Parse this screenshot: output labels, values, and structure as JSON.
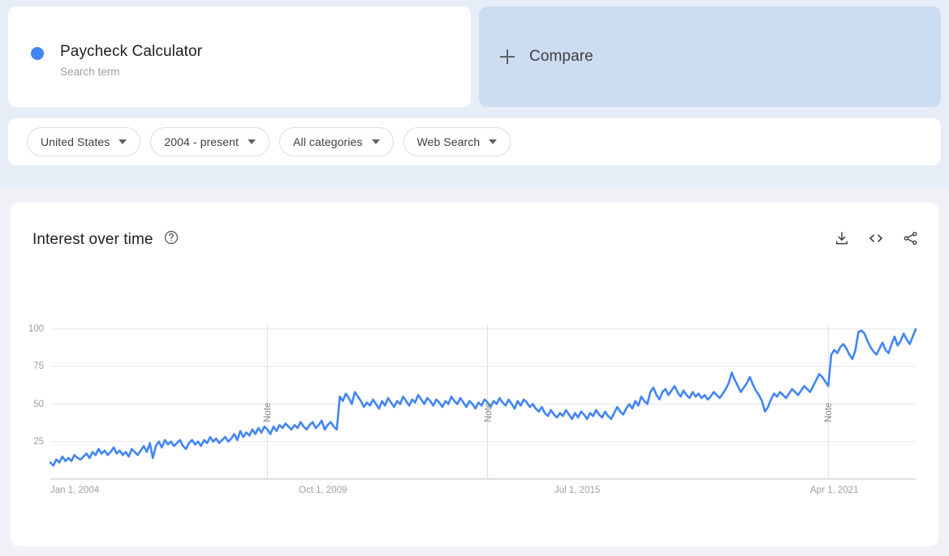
{
  "search_term": {
    "title": "Paycheck Calculator",
    "subtitle": "Search term",
    "dot_color": "#4285f4"
  },
  "compare": {
    "label": "Compare",
    "icon": "plus-icon",
    "background": "#ccdcf1"
  },
  "filters": [
    {
      "label": "United States",
      "icon": "chevron-down-icon"
    },
    {
      "label": "2004 - present",
      "icon": "chevron-down-icon"
    },
    {
      "label": "All categories",
      "icon": "chevron-down-icon"
    },
    {
      "label": "Web Search",
      "icon": "chevron-down-icon"
    }
  ],
  "chart_card": {
    "title": "Interest over time",
    "help_icon": "help-circle-icon",
    "actions": [
      {
        "name": "download-icon"
      },
      {
        "name": "embed-code-icon"
      },
      {
        "name": "share-icon"
      }
    ]
  },
  "chart_data": {
    "type": "line",
    "title": "Interest over time",
    "xlabel": "",
    "ylabel": "",
    "ylim": [
      0,
      100
    ],
    "grid": true,
    "legend_position": "none",
    "line_color": "#4285f4",
    "series_name": "Paycheck Calculator",
    "ticks": {
      "y": [
        25,
        50,
        75,
        100
      ],
      "x": [
        "Jan 1, 2004",
        "Oct 1, 2009",
        "Jul 1, 2015",
        "Apr 1, 2021"
      ]
    },
    "annotations": [
      {
        "label": "Note",
        "x_index": 72
      },
      {
        "label": "Note",
        "x_index": 145
      },
      {
        "label": "Note",
        "x_index": 258
      }
    ],
    "x_labels": [
      "Jan 1, 2004",
      "Oct 1, 2009",
      "Jul 1, 2015",
      "Apr 1, 2021"
    ],
    "values": [
      11,
      9,
      13,
      11,
      15,
      12,
      14,
      12,
      16,
      14,
      13,
      15,
      17,
      14,
      18,
      16,
      20,
      17,
      19,
      16,
      18,
      21,
      17,
      19,
      16,
      18,
      15,
      20,
      18,
      16,
      19,
      22,
      18,
      24,
      14,
      22,
      25,
      21,
      26,
      23,
      25,
      22,
      24,
      26,
      22,
      20,
      24,
      26,
      23,
      25,
      22,
      26,
      24,
      28,
      25,
      27,
      24,
      26,
      28,
      25,
      27,
      30,
      26,
      32,
      28,
      31,
      29,
      33,
      30,
      34,
      31,
      35,
      33,
      30,
      35,
      32,
      36,
      34,
      37,
      35,
      33,
      36,
      34,
      38,
      35,
      33,
      36,
      38,
      34,
      36,
      39,
      33,
      36,
      38,
      35,
      33,
      55,
      52,
      57,
      54,
      50,
      58,
      55,
      52,
      48,
      51,
      49,
      53,
      50,
      47,
      52,
      49,
      54,
      51,
      48,
      52,
      50,
      55,
      52,
      49,
      53,
      51,
      56,
      53,
      50,
      54,
      52,
      49,
      53,
      51,
      48,
      52,
      50,
      55,
      52,
      50,
      54,
      51,
      48,
      52,
      50,
      47,
      51,
      49,
      53,
      51,
      48,
      52,
      50,
      54,
      51,
      49,
      53,
      50,
      47,
      52,
      49,
      53,
      51,
      48,
      50,
      47,
      45,
      48,
      44,
      42,
      46,
      43,
      41,
      44,
      42,
      46,
      43,
      40,
      44,
      41,
      45,
      43,
      40,
      44,
      42,
      46,
      43,
      41,
      45,
      42,
      40,
      44,
      48,
      45,
      43,
      47,
      50,
      47,
      52,
      49,
      55,
      52,
      50,
      58,
      61,
      56,
      53,
      58,
      60,
      56,
      59,
      62,
      58,
      55,
      59,
      56,
      54,
      58,
      55,
      57,
      54,
      56,
      53,
      55,
      58,
      56,
      54,
      57,
      60,
      64,
      71,
      66,
      62,
      58,
      61,
      64,
      68,
      63,
      59,
      56,
      52,
      45,
      48,
      53,
      57,
      55,
      58,
      56,
      54,
      57,
      60,
      58,
      56,
      59,
      62,
      60,
      58,
      62,
      66,
      70,
      68,
      65,
      62,
      83,
      86,
      84,
      88,
      90,
      87,
      83,
      80,
      86,
      98,
      99,
      97,
      92,
      88,
      85,
      83,
      87,
      91,
      86,
      84,
      90,
      95,
      89,
      92,
      97,
      93,
      90,
      95,
      100
    ]
  }
}
